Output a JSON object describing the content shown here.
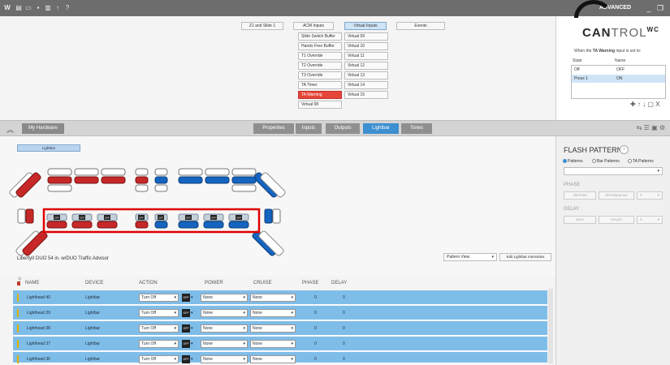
{
  "app": {
    "mode_label": "ADVANCED",
    "logo": {
      "main": "CAN",
      "thin": "TROL",
      "sup": "WC"
    }
  },
  "top_tabs": [
    {
      "label": "Z1 and Slide 1"
    },
    {
      "label": "ACM Inputs"
    },
    {
      "label": "Virtual Inputs"
    },
    {
      "label": "Events"
    }
  ],
  "inputs_left": [
    "Slide Switch Buffer",
    "Hands Free Buffer",
    "T1 Override",
    "T2 Override",
    "T3 Override",
    "TA Timer",
    "TA Warning",
    "Virtual 08"
  ],
  "inputs_right": [
    "Virtual 09",
    "Virtual 10",
    "Virtual 11",
    "Virtual 12",
    "Virtual 13",
    "Virtual 14",
    "Virtual 15"
  ],
  "state_panel": {
    "when_prefix": "When the",
    "when_input": "TA Warning",
    "when_suffix": "input is set to:",
    "col_state": "State",
    "col_name": "Name",
    "rows": [
      {
        "state": "Off",
        "name": "OFF"
      },
      {
        "state": "Press 1",
        "name": "ON"
      }
    ],
    "tools": "✚ ↑ ↓ ▢ X"
  },
  "hardware": {
    "button": "My Hardware",
    "tabs": [
      "Properties",
      "Inputs",
      "Outputs",
      "Lightbar",
      "Tones"
    ],
    "tools": "⇆ ☰ ▣ ⚙"
  },
  "lightbar": {
    "button": "Lightbar",
    "device_title": "LibertyII DUO 54 in. w/DUO Traffic Advisor",
    "pattern_view": "Pattern View",
    "edit_intensities": "Edit Lightbar Intensities",
    "off_label": "OFF"
  },
  "flash_pattern": {
    "title": "FLASH PATTERN",
    "arrow": "›",
    "radios": [
      "Patterns",
      "Bar Patterns",
      "TA Patterns"
    ],
    "phase_label": "PHASE",
    "alternate": "Alternate",
    "simultaneous": "Simultaneous",
    "phase_value": "0",
    "delay_label": "DELAY",
    "sync": "Sync",
    "unsync": "Unsync",
    "delay_value": "0"
  },
  "table": {
    "headers": [
      "NAME",
      "DEVICE",
      "ACTION",
      "POWER",
      "CRUISE",
      "PHASE",
      "DELAY"
    ],
    "rows": [
      {
        "name": "Lighthead 40",
        "device": "Lightbar",
        "action": "Turn Off",
        "power": "None",
        "cruise": "None",
        "phase": "0",
        "delay": "0"
      },
      {
        "name": "Lighthead 39",
        "device": "Lightbar",
        "action": "Turn Off",
        "power": "None",
        "cruise": "None",
        "phase": "0",
        "delay": "0"
      },
      {
        "name": "Lighthead 38",
        "device": "Lightbar",
        "action": "Turn Off",
        "power": "None",
        "cruise": "None",
        "phase": "0",
        "delay": "0"
      },
      {
        "name": "Lighthead 37",
        "device": "Lightbar",
        "action": "Turn Off",
        "power": "None",
        "cruise": "None",
        "phase": "0",
        "delay": "0"
      },
      {
        "name": "Lighthead 36",
        "device": "Lightbar",
        "action": "Turn Off",
        "power": "None",
        "cruise": "None",
        "phase": "0",
        "delay": "0"
      }
    ]
  },
  "colors": {
    "red": "#c62828",
    "blue": "#1565c0",
    "highlight": "#e00000",
    "row": "#7fbde9",
    "accent": "#3d8fd0"
  }
}
